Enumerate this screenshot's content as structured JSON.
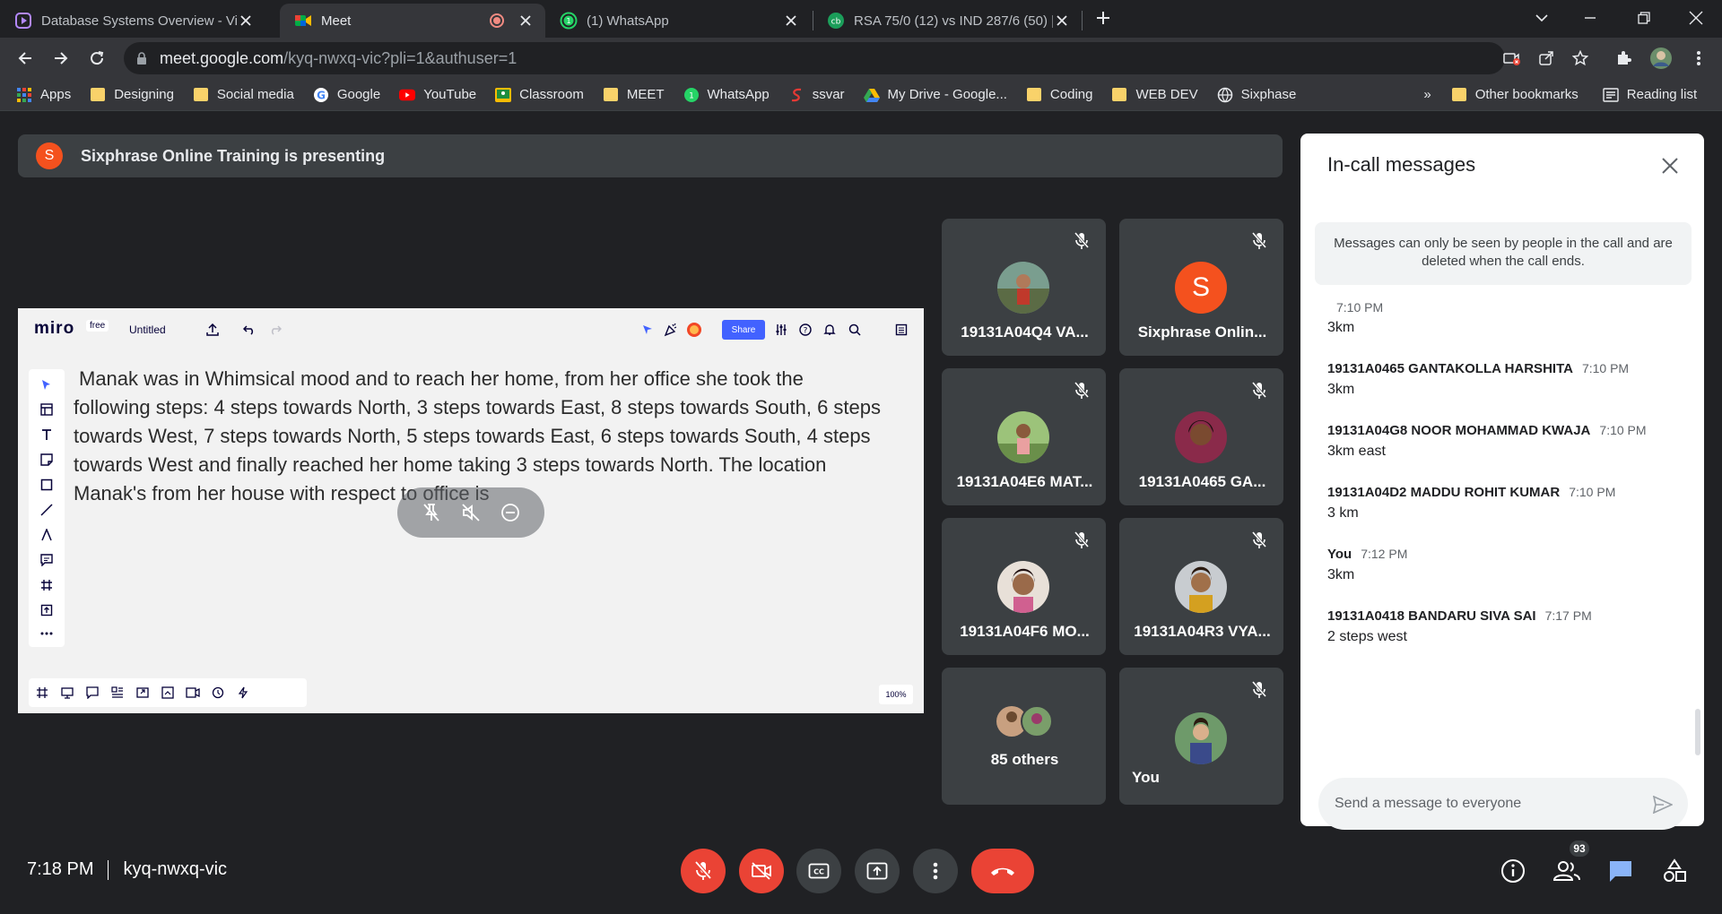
{
  "browser": {
    "tabs": [
      {
        "title": "Database Systems Overview - Vid",
        "active": false
      },
      {
        "title": "Meet",
        "active": true
      },
      {
        "title": "(1) WhatsApp",
        "active": false
      },
      {
        "title": "RSA 75/0 (12) vs IND 287/6 (50) |",
        "active": false
      }
    ],
    "url_host": "meet.google.com",
    "url_path": "/kyq-nwxq-vic?pli=1&authuser=1",
    "bookmarks": [
      {
        "label": "Apps",
        "icon": "apps-grid-icon"
      },
      {
        "label": "Designing",
        "icon": "folder-icon"
      },
      {
        "label": "Social media",
        "icon": "folder-icon"
      },
      {
        "label": "Google",
        "icon": "google-icon"
      },
      {
        "label": "YouTube",
        "icon": "youtube-icon"
      },
      {
        "label": "Classroom",
        "icon": "classroom-icon"
      },
      {
        "label": "MEET",
        "icon": "folder-icon"
      },
      {
        "label": "WhatsApp",
        "icon": "whatsapp-icon"
      },
      {
        "label": "ssvar",
        "icon": "ssvar-icon"
      },
      {
        "label": "My Drive - Google...",
        "icon": "drive-icon"
      },
      {
        "label": "Coding",
        "icon": "folder-icon"
      },
      {
        "label": "WEB DEV",
        "icon": "folder-icon"
      },
      {
        "label": "Sixphase",
        "icon": "globe-icon"
      }
    ],
    "more_bookmarks": "»",
    "other_bookmarks": "Other bookmarks",
    "reading_list": "Reading list"
  },
  "meet": {
    "presenting_avatar": "S",
    "presenting_text": "Sixphrase Online Training is presenting",
    "shared_screen": {
      "miro_logo": "miro",
      "miro_plan": "free",
      "board_name": "Untitled",
      "share_label": "Share",
      "zoom": "100%",
      "question": "Manak was in Whimsical mood and to reach her home, from her office she took the following steps: 4 steps towards North, 3 steps towards East, 8 steps towards South, 6 steps towards West, 7 steps towards North, 5 steps towards East, 6 steps towards South, 4 steps towards West and finally reached her home taking 3 steps towards North. The location Manak's from her house with respect to office is"
    },
    "participants": [
      {
        "name": "19131A04Q4 VA...",
        "avatar": "photo",
        "muted": true
      },
      {
        "name": "Sixphrase Onlin...",
        "avatar": "S",
        "muted": true
      },
      {
        "name": "19131A04E6 MAT...",
        "avatar": "photo",
        "muted": true
      },
      {
        "name": "19131A0465 GA...",
        "avatar": "photo",
        "muted": true
      },
      {
        "name": "19131A04F6 MO...",
        "avatar": "photo",
        "muted": true
      },
      {
        "name": "19131A04R3 VYA...",
        "avatar": "photo",
        "muted": true
      },
      {
        "name": "85 others",
        "avatar": "group",
        "muted": false
      },
      {
        "name": "You",
        "avatar": "photo",
        "muted": true
      }
    ],
    "chat": {
      "title": "In-call messages",
      "notice": "Messages can only be seen by people in the call and are deleted when the call ends.",
      "messages": [
        {
          "sender": "",
          "time": "7:10 PM",
          "text": "3km"
        },
        {
          "sender": "19131A0465 GANTAKOLLA HARSHITA",
          "time": "7:10 PM",
          "text": "3km"
        },
        {
          "sender": "19131A04G8 NOOR MOHAMMAD KWAJA",
          "time": "7:10 PM",
          "text": "3km east"
        },
        {
          "sender": "19131A04D2 MADDU ROHIT KUMAR",
          "time": "7:10 PM",
          "text": "3 km"
        },
        {
          "sender": "You",
          "time": "7:12 PM",
          "text": "3km"
        },
        {
          "sender": "19131A0418 BANDARU SIVA SAI",
          "time": "7:17 PM",
          "text": "2 steps west"
        }
      ],
      "input_placeholder": "Send a message to everyone"
    },
    "bottom": {
      "time": "7:18 PM",
      "meeting_code": "kyq-nwxq-vic",
      "people_count": "93"
    }
  },
  "colors": {
    "meet_bg": "#202124",
    "tile_bg": "#3c4043",
    "danger_red": "#ea4335",
    "accent_blue": "#8ab4f8",
    "avatar_orange": "#f4511e"
  }
}
